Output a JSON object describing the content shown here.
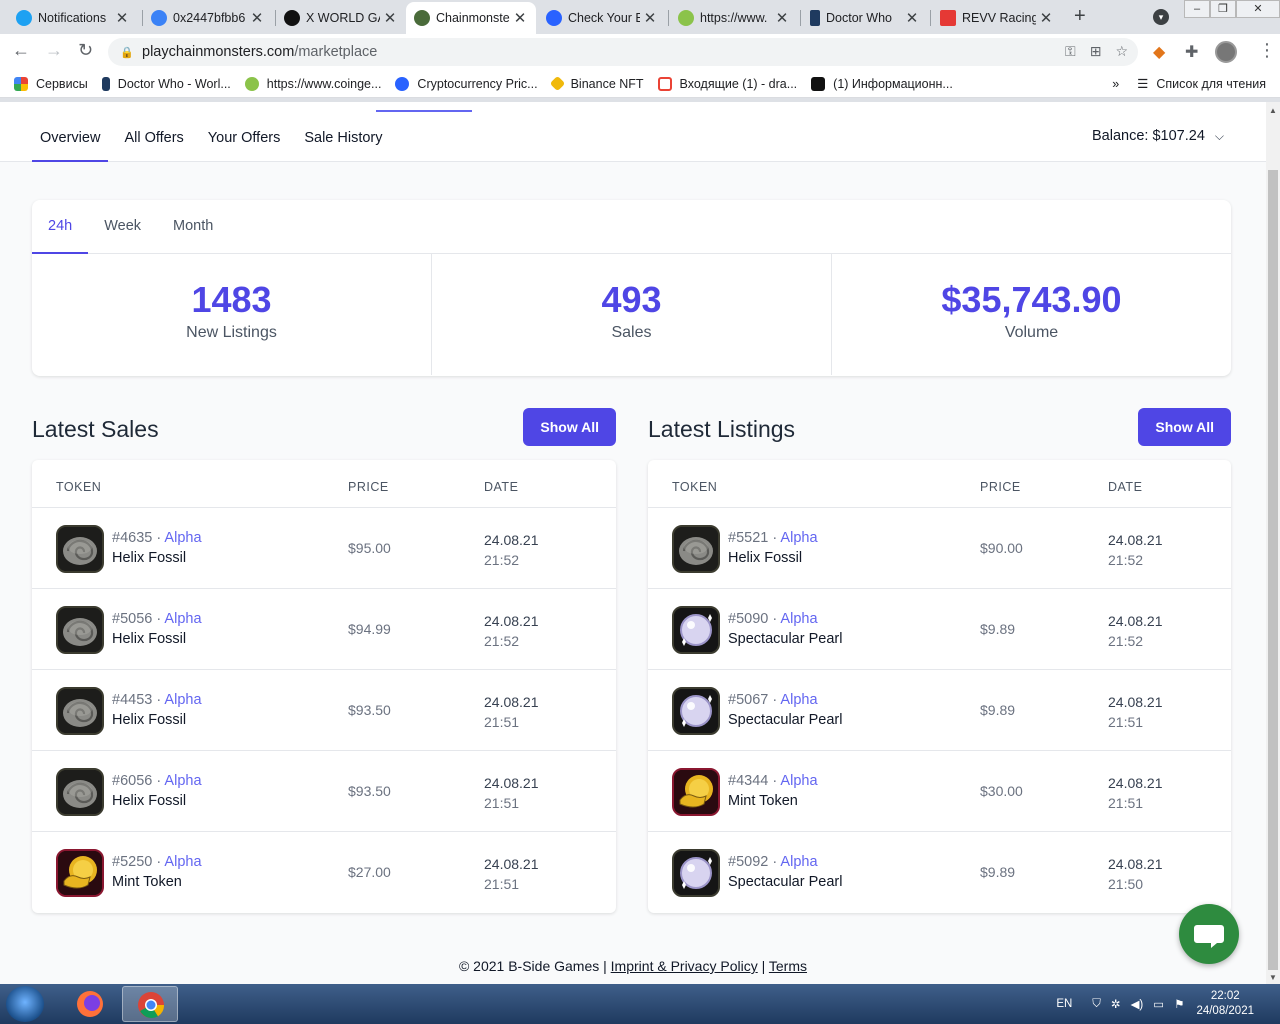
{
  "browser": {
    "tabs": [
      {
        "title": "Notifications",
        "color": "#1da1f2"
      },
      {
        "title": "0x2447bfbb6",
        "color": "#3b82f6"
      },
      {
        "title": "X WORLD GA",
        "color": "#111111"
      },
      {
        "title": "Chainmonste",
        "color": "#4a6b3a"
      },
      {
        "title": "Check Your E",
        "color": "#2962ff"
      },
      {
        "title": "https://www.",
        "color": "#8bc34a"
      },
      {
        "title": "Doctor Who",
        "color": "#1f3a5f"
      },
      {
        "title": "REVV Racing",
        "color": "#e53935"
      }
    ],
    "url_host": "playchainmonsters.com",
    "url_path": "/marketplace",
    "bookmarks": [
      {
        "label": "Сервисы",
        "color": "#ea4335"
      },
      {
        "label": "Doctor Who - Worl...",
        "color": "#1f3a5f"
      },
      {
        "label": "https://www.coinge...",
        "color": "#8bc34a"
      },
      {
        "label": "Cryptocurrency Pric...",
        "color": "#2962ff"
      },
      {
        "label": "Binance NFT",
        "color": "#f0b90b"
      },
      {
        "label": "Входящие (1) - dra...",
        "color": "#ea4335"
      },
      {
        "label": "(1) Информационн...",
        "color": "#111111"
      }
    ],
    "reading_list": "Список для чтения",
    "more": "»"
  },
  "nav": {
    "items": [
      "Overview",
      "All Offers",
      "Your Offers",
      "Sale History"
    ],
    "balance": "Balance: $107.24"
  },
  "stats": {
    "periods": [
      "24h",
      "Week",
      "Month"
    ],
    "items": [
      {
        "value": "1483",
        "label": "New Listings"
      },
      {
        "value": "493",
        "label": "Sales"
      },
      {
        "value": "$35,743.90",
        "label": "Volume"
      }
    ]
  },
  "latest_sales": {
    "title": "Latest Sales",
    "button": "Show All",
    "columns": [
      "TOKEN",
      "PRICE",
      "DATE"
    ],
    "rows": [
      {
        "id": "#4635",
        "rarity": "Alpha",
        "name": "Helix Fossil",
        "price": "$95.00",
        "date": "24.08.21",
        "time": "21:52",
        "icon": "fossil"
      },
      {
        "id": "#5056",
        "rarity": "Alpha",
        "name": "Helix Fossil",
        "price": "$94.99",
        "date": "24.08.21",
        "time": "21:52",
        "icon": "fossil"
      },
      {
        "id": "#4453",
        "rarity": "Alpha",
        "name": "Helix Fossil",
        "price": "$93.50",
        "date": "24.08.21",
        "time": "21:51",
        "icon": "fossil"
      },
      {
        "id": "#6056",
        "rarity": "Alpha",
        "name": "Helix Fossil",
        "price": "$93.50",
        "date": "24.08.21",
        "time": "21:51",
        "icon": "fossil"
      },
      {
        "id": "#5250",
        "rarity": "Alpha",
        "name": "Mint Token",
        "price": "$27.00",
        "date": "24.08.21",
        "time": "21:51",
        "icon": "mint"
      }
    ]
  },
  "latest_listings": {
    "title": "Latest Listings",
    "button": "Show All",
    "columns": [
      "TOKEN",
      "PRICE",
      "DATE"
    ],
    "rows": [
      {
        "id": "#5521",
        "rarity": "Alpha",
        "name": "Helix Fossil",
        "price": "$90.00",
        "date": "24.08.21",
        "time": "21:52",
        "icon": "fossil"
      },
      {
        "id": "#5090",
        "rarity": "Alpha",
        "name": "Spectacular Pearl",
        "price": "$9.89",
        "date": "24.08.21",
        "time": "21:52",
        "icon": "pearl"
      },
      {
        "id": "#5067",
        "rarity": "Alpha",
        "name": "Spectacular Pearl",
        "price": "$9.89",
        "date": "24.08.21",
        "time": "21:51",
        "icon": "pearl"
      },
      {
        "id": "#4344",
        "rarity": "Alpha",
        "name": "Mint Token",
        "price": "$30.00",
        "date": "24.08.21",
        "time": "21:51",
        "icon": "mint"
      },
      {
        "id": "#5092",
        "rarity": "Alpha",
        "name": "Spectacular Pearl",
        "price": "$9.89",
        "date": "24.08.21",
        "time": "21:50",
        "icon": "pearl"
      }
    ]
  },
  "footer": {
    "copyright": "© 2021 B-Side Games |",
    "imprint": "Imprint & Privacy Policy",
    "sep": "|",
    "terms": "Terms"
  },
  "taskbar": {
    "lang": "EN",
    "time": "22:02",
    "date": "24/08/2021"
  },
  "colors": {
    "accent": "#4f46e5",
    "alpha": "#6366f1"
  }
}
